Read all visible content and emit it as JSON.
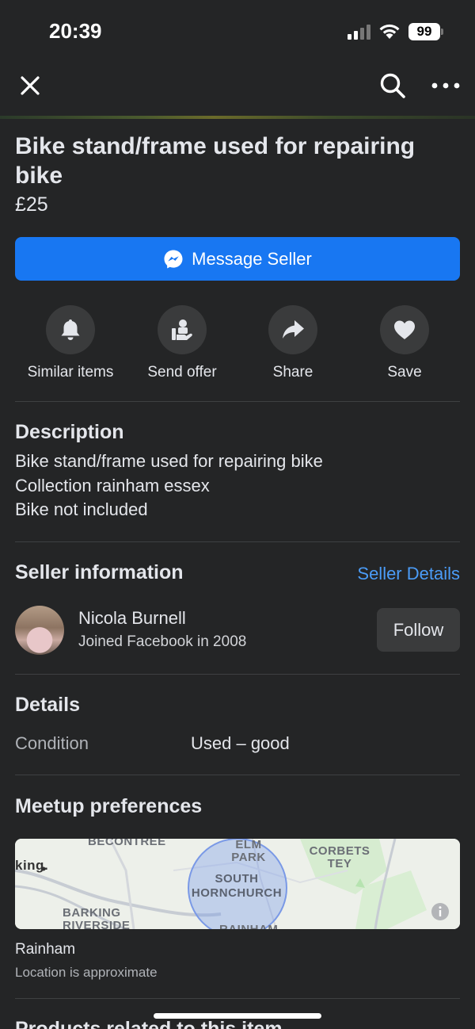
{
  "status_bar": {
    "time": "20:39",
    "battery": "99"
  },
  "listing": {
    "title": "Bike stand/frame used for repairing bike",
    "price": "£25"
  },
  "primary_action": {
    "label": "Message Seller",
    "color": "#1877f2"
  },
  "actions": [
    {
      "label": "Similar items",
      "icon": "bell-icon"
    },
    {
      "label": "Send offer",
      "icon": "offer-icon"
    },
    {
      "label": "Share",
      "icon": "share-icon"
    },
    {
      "label": "Save",
      "icon": "heart-icon"
    }
  ],
  "description": {
    "heading": "Description",
    "lines": [
      "Bike stand/frame used for repairing bike",
      "Collection rainham essex",
      "Bike not included"
    ]
  },
  "seller": {
    "heading": "Seller information",
    "details_link": "Seller Details",
    "name": "Nicola Burnell",
    "joined": "Joined Facebook in 2008",
    "follow_label": "Follow"
  },
  "details": {
    "heading": "Details",
    "condition_label": "Condition",
    "condition_value": "Used – good"
  },
  "meetup": {
    "heading": "Meetup preferences",
    "map_labels": [
      "BECONTREE",
      "king.",
      "BARKING RIVERSIDE",
      "ELM PARK",
      "SOUTH HORNCHURCH",
      "RAINHAM",
      "CORBETS TEY"
    ],
    "location": "Rainham",
    "note": "Location is approximate"
  },
  "next_section": "Products related to this item"
}
